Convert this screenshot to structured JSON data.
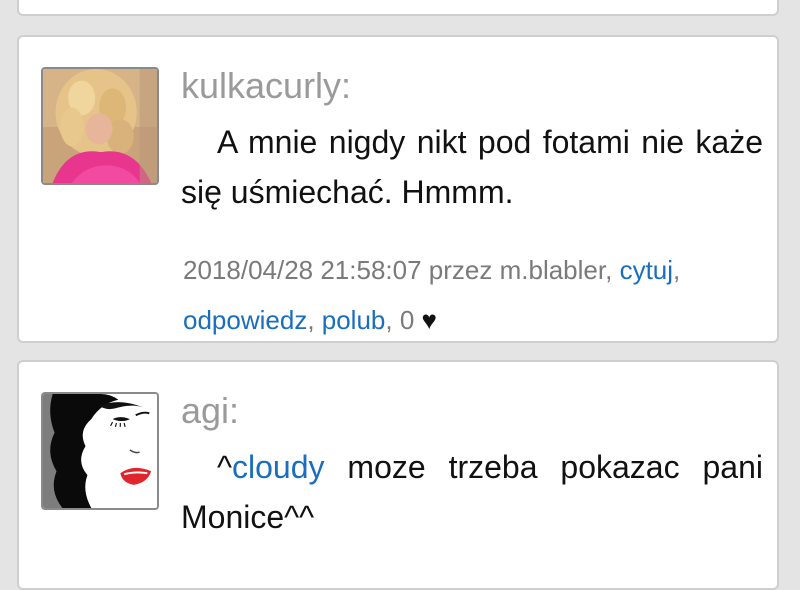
{
  "posts": [
    {
      "username": "kulkacurly:",
      "text": "A mnie nigdy nikt pod fotami nie każe się uśmiechać. Hmmm.",
      "timestamp": "2018/04/28 21:58:07",
      "via": "przez m.blabler,",
      "actions": {
        "quote": "cytuj",
        "reply": "odpowiedz",
        "like": "polub"
      },
      "likes": "0",
      "heart": "♥"
    },
    {
      "username": "agi:",
      "text_prefix": "^",
      "mention": "cloudy",
      "text_suffix": " moze trzeba pokazac pani Monice^^"
    }
  ],
  "colors": {
    "link": "#1a6fbd",
    "username": "#9a9a9a",
    "card_border": "#cfcfcf",
    "page_bg": "#e4e4e4"
  }
}
